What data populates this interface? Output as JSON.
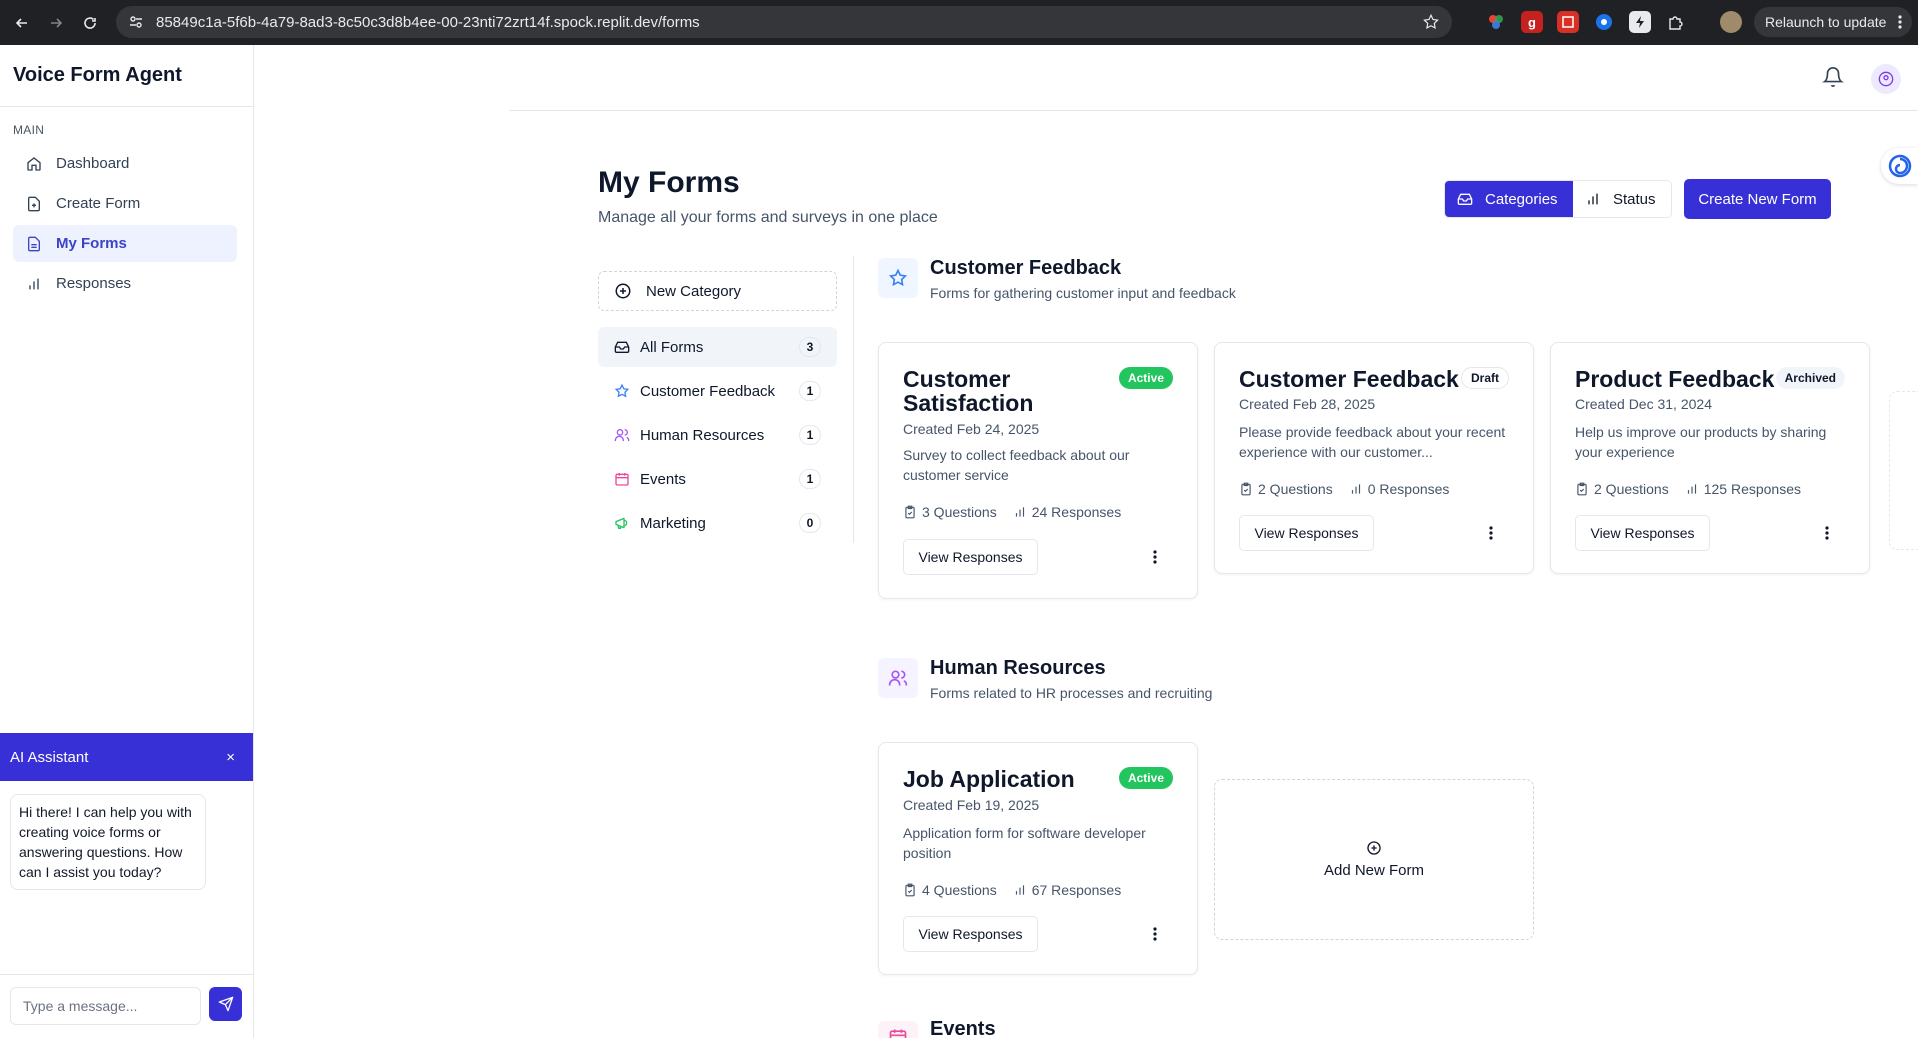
{
  "browser": {
    "url": "85849c1a-5f6b-4a79-8ad3-8c50c3d8b4ee-00-23nti72zrt14f.spock.replit.dev/forms",
    "relaunch_label": "Relaunch to update"
  },
  "sidebar": {
    "app_name": "Voice Form Agent",
    "section_label": "MAIN",
    "items": [
      {
        "label": "Dashboard",
        "icon": "home-icon"
      },
      {
        "label": "Create Form",
        "icon": "file-plus-icon"
      },
      {
        "label": "My Forms",
        "icon": "file-text-icon",
        "active": true
      },
      {
        "label": "Responses",
        "icon": "bar-chart-icon"
      }
    ]
  },
  "assistant": {
    "title": "AI Assistant",
    "close_label": "×",
    "message": "Hi there! I can help you with creating voice forms or answering questions. How can I assist you today?",
    "input_placeholder": "Type a message..."
  },
  "header": {
    "title": "My Forms",
    "subtitle": "Manage all your forms and surveys in one place",
    "view_toggle": {
      "categories_label": "Categories",
      "status_label": "Status",
      "selected": "Categories"
    },
    "create_label": "Create New Form"
  },
  "categories": {
    "new_category_label": "New Category",
    "items": [
      {
        "label": "All Forms",
        "count": "3",
        "icon": "inbox-icon",
        "active": true
      },
      {
        "label": "Customer Feedback",
        "count": "1",
        "icon": "star-icon"
      },
      {
        "label": "Human Resources",
        "count": "1",
        "icon": "users-icon"
      },
      {
        "label": "Events",
        "count": "1",
        "icon": "calendar-icon"
      },
      {
        "label": "Marketing",
        "count": "0",
        "icon": "megaphone-icon"
      }
    ]
  },
  "groups": [
    {
      "title": "Customer Feedback",
      "subtitle": "Forms for gathering customer input and feedback",
      "icon": "star-icon",
      "forms": [
        {
          "title": "Customer Satisfaction",
          "status": "Active",
          "created": "Created Feb 24, 2025",
          "description": "Survey to collect feedback about our customer service",
          "questions": "3 Questions",
          "responses": "24 Responses",
          "action": "View Responses"
        },
        {
          "title": "Customer Feedback",
          "status": "Draft",
          "created": "Created Feb 28, 2025",
          "description": "Please provide feedback about your recent experience with our customer...",
          "questions": "2 Questions",
          "responses": "0 Responses",
          "action": "View Responses"
        },
        {
          "title": "Product Feedback",
          "status": "Archived",
          "created": "Created Dec 31, 2024",
          "description": "Help us improve our products by sharing your experience",
          "questions": "2 Questions",
          "responses": "125 Responses",
          "action": "View Responses"
        }
      ]
    },
    {
      "title": "Human Resources",
      "subtitle": "Forms related to HR processes and recruiting",
      "icon": "users-icon",
      "forms": [
        {
          "title": "Job Application",
          "status": "Active",
          "created": "Created Feb 19, 2025",
          "description": "Application form for software developer position",
          "questions": "4 Questions",
          "responses": "67 Responses",
          "action": "View Responses"
        }
      ],
      "add_label": "Add New Form"
    },
    {
      "title": "Events",
      "icon": "calendar-icon"
    }
  ],
  "colors": {
    "accent": "#3730d6",
    "active_badge": "#22c55e",
    "nav_active_bg": "#eef2ff"
  }
}
